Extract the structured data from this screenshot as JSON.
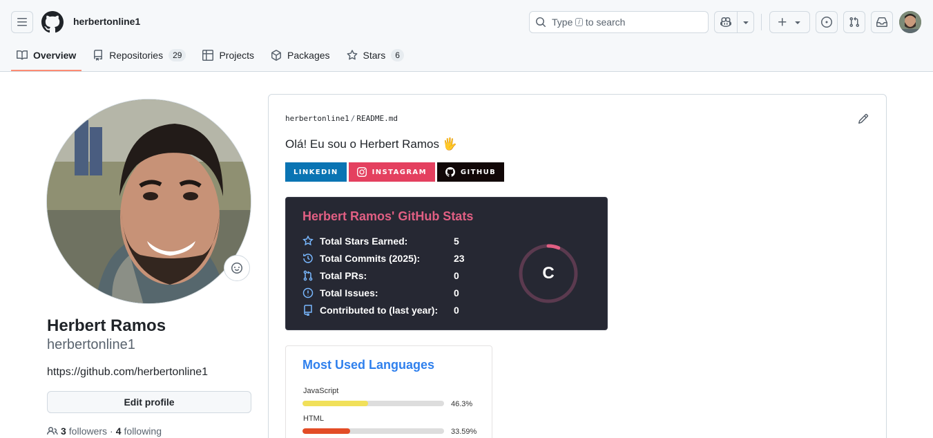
{
  "header": {
    "username": "herbertonline1",
    "search": {
      "before": "Type",
      "key": "/",
      "after": "to search"
    }
  },
  "tabs": [
    {
      "label": "Overview",
      "active": true
    },
    {
      "label": "Repositories",
      "count": "29"
    },
    {
      "label": "Projects"
    },
    {
      "label": "Packages"
    },
    {
      "label": "Stars",
      "count": "6"
    }
  ],
  "profile": {
    "name": "Herbert Ramos",
    "login": "herbertonline1",
    "url": "https://github.com/herbertonline1",
    "edit_label": "Edit profile",
    "followers_count": "3",
    "followers_label": "followers",
    "separator": "·",
    "following_count": "4",
    "following_label": "following"
  },
  "readme": {
    "owner": "herbertonline1",
    "sep": "/",
    "file": "README.md",
    "greeting": "Olá! Eu sou o Herbert Ramos 🖐️",
    "badges": [
      {
        "label": "LINKEDIN",
        "color": "#0a74b3"
      },
      {
        "label": "INSTAGRAM",
        "color": "#e4405f"
      },
      {
        "label": "GITHUB",
        "color": "#110707"
      }
    ],
    "stats": {
      "title": "Herbert Ramos' GitHub Stats",
      "rows": [
        {
          "label": "Total Stars Earned:",
          "value": "5",
          "icon": "star-icon"
        },
        {
          "label": "Total Commits (2025):",
          "value": "23",
          "icon": "history-icon"
        },
        {
          "label": "Total PRs:",
          "value": "0",
          "icon": "pull-request-icon"
        },
        {
          "label": "Total Issues:",
          "value": "0",
          "icon": "issue-icon"
        },
        {
          "label": "Contributed to (last year):",
          "value": "0",
          "icon": "repo-icon"
        }
      ],
      "rank": "C",
      "rank_progress": 0.06,
      "title_color": "#e15f83",
      "icon_color": "#79b8ff",
      "bg_color": "#262833"
    },
    "languages": {
      "title": "Most Used Languages",
      "items": [
        {
          "name": "JavaScript",
          "percent_label": "46.3%",
          "percent": 46.3,
          "color": "#f1e05a"
        },
        {
          "name": "HTML",
          "percent_label": "33.59%",
          "percent": 33.59,
          "color": "#e34c26"
        }
      ]
    }
  }
}
